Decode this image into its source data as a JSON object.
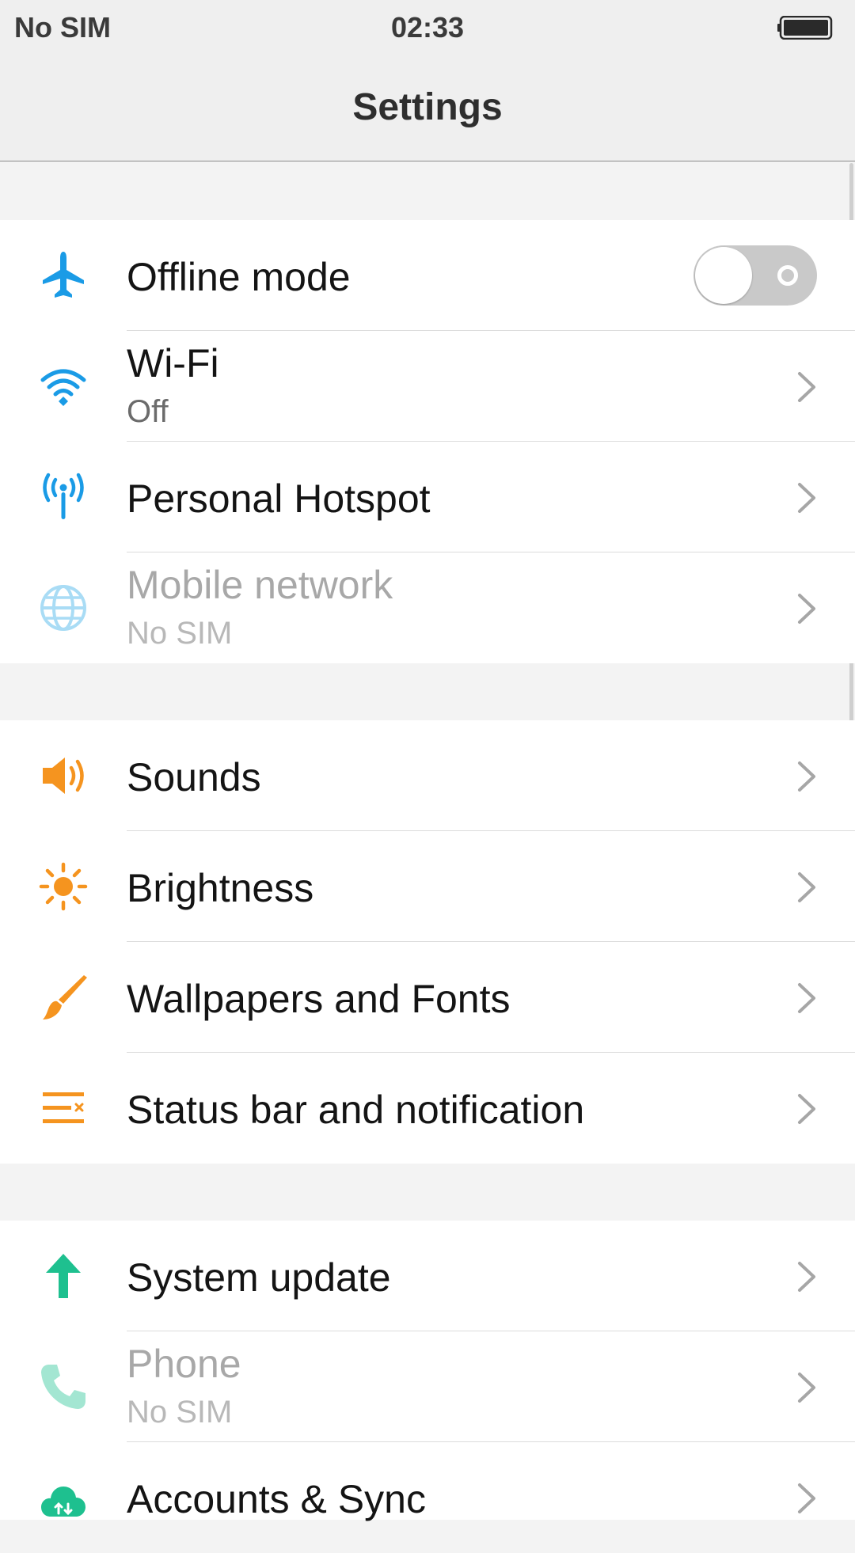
{
  "status_bar": {
    "carrier": "No SIM",
    "time": "02:33",
    "battery_icon": "battery-full-icon"
  },
  "header": {
    "title": "Settings"
  },
  "colors": {
    "blue_accent": "#1a9be6",
    "orange_accent": "#f5941f",
    "green_accent": "#1ec08f",
    "toggle_off": "#c9c9c9",
    "background": "#f3f3f3"
  },
  "groups": [
    {
      "items": [
        {
          "label": "Offline mode",
          "icon": "airplane-icon",
          "control": "toggle",
          "toggle_on": false
        },
        {
          "label": "Wi-Fi",
          "sub": "Off",
          "icon": "wifi-icon",
          "control": "chevron"
        },
        {
          "label": "Personal Hotspot",
          "icon": "hotspot-icon",
          "control": "chevron"
        },
        {
          "label": "Mobile network",
          "sub": "No SIM",
          "icon": "globe-icon",
          "control": "chevron",
          "disabled": true
        }
      ]
    },
    {
      "items": [
        {
          "label": "Sounds",
          "icon": "speaker-icon",
          "control": "chevron"
        },
        {
          "label": "Brightness",
          "icon": "sun-icon",
          "control": "chevron"
        },
        {
          "label": "Wallpapers and Fonts",
          "icon": "paintbrush-icon",
          "control": "chevron"
        },
        {
          "label": "Status bar and notification",
          "icon": "status-bar-icon",
          "control": "chevron"
        }
      ]
    },
    {
      "items": [
        {
          "label": "System update",
          "icon": "arrow-up-icon",
          "control": "chevron"
        },
        {
          "label": "Phone",
          "sub": "No SIM",
          "icon": "phone-icon",
          "control": "chevron",
          "disabled": true
        },
        {
          "label": "Accounts & Sync",
          "icon": "cloud-sync-icon",
          "control": "chevron"
        }
      ]
    }
  ]
}
